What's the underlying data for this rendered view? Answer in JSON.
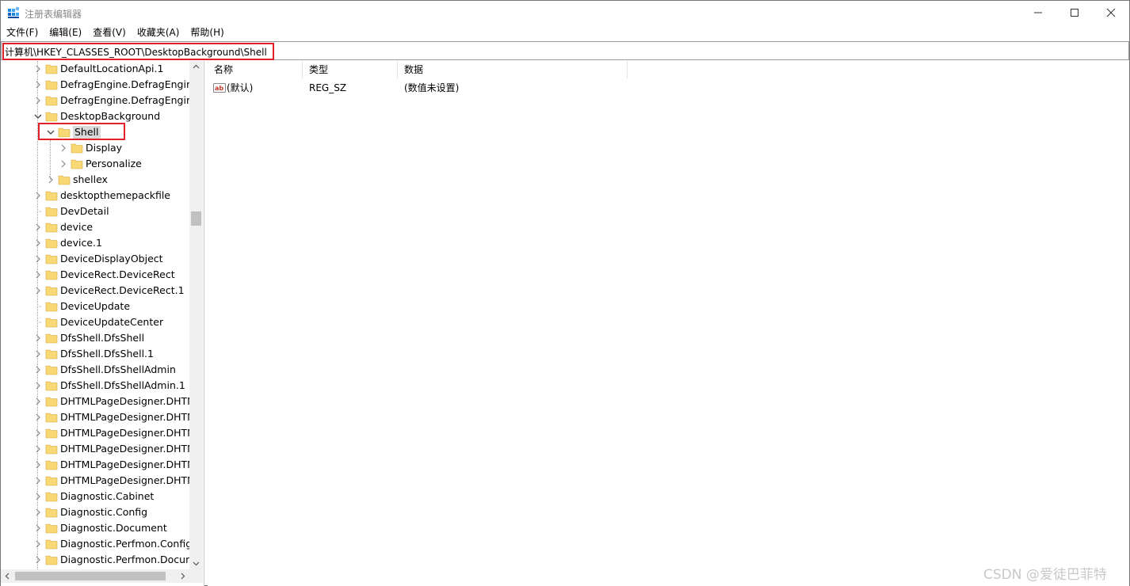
{
  "window": {
    "title": "注册表编辑器",
    "controls": {
      "minimize": "—",
      "maximize": "☐",
      "close": "✕"
    }
  },
  "menu": [
    "文件(F)",
    "编辑(E)",
    "查看(V)",
    "收藏夹(A)",
    "帮助(H)"
  ],
  "address": {
    "path": "计算机\\HKEY_CLASSES_ROOT\\DesktopBackground\\Shell"
  },
  "tree": {
    "items": [
      {
        "label": "DefaultLocationApi.1",
        "level": 0,
        "expander": "collapsed"
      },
      {
        "label": "DefragEngine.DefragEngine",
        "level": 0,
        "expander": "collapsed"
      },
      {
        "label": "DefragEngine.DefragEngine.",
        "level": 0,
        "expander": "collapsed"
      },
      {
        "label": "DesktopBackground",
        "level": 0,
        "expander": "expanded"
      },
      {
        "label": "Shell",
        "level": 1,
        "expander": "expanded",
        "selected": true
      },
      {
        "label": "Display",
        "level": 2,
        "expander": "collapsed"
      },
      {
        "label": "Personalize",
        "level": 2,
        "expander": "collapsed"
      },
      {
        "label": "shellex",
        "level": 1,
        "expander": "collapsed"
      },
      {
        "label": "desktopthemepackfile",
        "level": 0,
        "expander": "collapsed"
      },
      {
        "label": "DevDetail",
        "level": 0,
        "expander": "none"
      },
      {
        "label": "device",
        "level": 0,
        "expander": "collapsed"
      },
      {
        "label": "device.1",
        "level": 0,
        "expander": "collapsed"
      },
      {
        "label": "DeviceDisplayObject",
        "level": 0,
        "expander": "collapsed"
      },
      {
        "label": "DeviceRect.DeviceRect",
        "level": 0,
        "expander": "collapsed"
      },
      {
        "label": "DeviceRect.DeviceRect.1",
        "level": 0,
        "expander": "collapsed"
      },
      {
        "label": "DeviceUpdate",
        "level": 0,
        "expander": "none"
      },
      {
        "label": "DeviceUpdateCenter",
        "level": 0,
        "expander": "none"
      },
      {
        "label": "DfsShell.DfsShell",
        "level": 0,
        "expander": "collapsed"
      },
      {
        "label": "DfsShell.DfsShell.1",
        "level": 0,
        "expander": "collapsed"
      },
      {
        "label": "DfsShell.DfsShellAdmin",
        "level": 0,
        "expander": "collapsed"
      },
      {
        "label": "DfsShell.DfsShellAdmin.1",
        "level": 0,
        "expander": "collapsed"
      },
      {
        "label": "DHTMLPageDesigner.DHTM",
        "level": 0,
        "expander": "collapsed"
      },
      {
        "label": "DHTMLPageDesigner.DHTM",
        "level": 0,
        "expander": "collapsed"
      },
      {
        "label": "DHTMLPageDesigner.DHTM",
        "level": 0,
        "expander": "collapsed"
      },
      {
        "label": "DHTMLPageDesigner.DHTM",
        "level": 0,
        "expander": "collapsed"
      },
      {
        "label": "DHTMLPageDesigner.DHTM",
        "level": 0,
        "expander": "collapsed"
      },
      {
        "label": "DHTMLPageDesigner.DHTM",
        "level": 0,
        "expander": "collapsed"
      },
      {
        "label": "Diagnostic.Cabinet",
        "level": 0,
        "expander": "collapsed"
      },
      {
        "label": "Diagnostic.Config",
        "level": 0,
        "expander": "collapsed"
      },
      {
        "label": "Diagnostic.Document",
        "level": 0,
        "expander": "collapsed"
      },
      {
        "label": "Diagnostic.Perfmon.Config",
        "level": 0,
        "expander": "collapsed"
      },
      {
        "label": "Diagnostic.Perfmon.Docume",
        "level": 0,
        "expander": "collapsed"
      }
    ]
  },
  "list": {
    "columns": [
      "名称",
      "类型",
      "数据"
    ],
    "rows": [
      {
        "name": "(默认)",
        "type": "REG_SZ",
        "data": "(数值未设置)",
        "icon": "string-value-icon"
      }
    ]
  },
  "watermark": "CSDN @爱徒巴菲特",
  "colors": {
    "highlight_box": "#e0202a",
    "folder": "#f8d775",
    "selected_bg": "#d9d9d9"
  }
}
